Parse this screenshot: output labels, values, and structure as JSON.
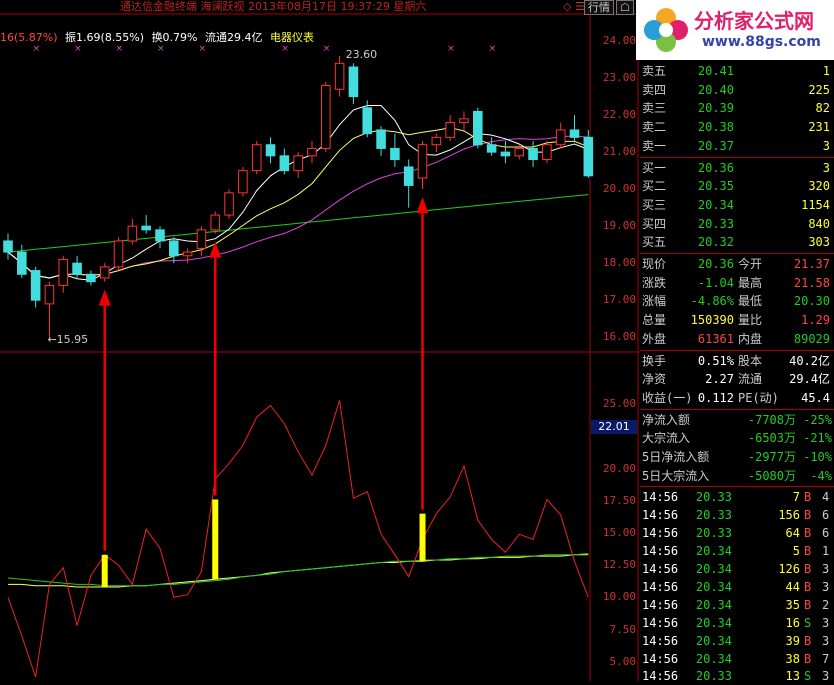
{
  "window": {
    "title": "通达信金融终端  海澜跃视 2013年08月17日 19:37:29 星期六",
    "quote_button": "行情",
    "extra_button": "☖",
    "small_controls": "◇ ☰"
  },
  "logo": {
    "line1": "分析家公式网",
    "line2": "www.88gs.com"
  },
  "info_bar": {
    "change": "16(5.87%)",
    "amplitude": "振1.69(8.55%)",
    "turnover": "换0.79%",
    "float": "流通29.4亿",
    "sector": "电器仪表"
  },
  "price_axis": [
    "24.00",
    "23.00",
    "22.00",
    "21.00",
    "20.00",
    "19.00",
    "18.00",
    "17.00",
    "16.00"
  ],
  "indicator_axis": [
    "25.00",
    "22.01",
    "20.00",
    "17.50",
    "15.00",
    "12.50",
    "10.00",
    "7.50",
    "5.00"
  ],
  "indicator_current": "22.01",
  "annotations": {
    "high": "23.60",
    "low": "←15.95"
  },
  "order_book": {
    "sell": [
      {
        "label": "卖五",
        "price": "20.41",
        "vol": "1"
      },
      {
        "label": "卖四",
        "price": "20.40",
        "vol": "225"
      },
      {
        "label": "卖三",
        "price": "20.39",
        "vol": "82"
      },
      {
        "label": "卖二",
        "price": "20.38",
        "vol": "231"
      },
      {
        "label": "卖一",
        "price": "20.37",
        "vol": "3"
      }
    ],
    "buy": [
      {
        "label": "买一",
        "price": "20.36",
        "vol": "3"
      },
      {
        "label": "买二",
        "price": "20.35",
        "vol": "320"
      },
      {
        "label": "买三",
        "price": "20.34",
        "vol": "1154"
      },
      {
        "label": "买四",
        "price": "20.33",
        "vol": "840"
      },
      {
        "label": "买五",
        "price": "20.32",
        "vol": "303"
      }
    ]
  },
  "stats": [
    {
      "l1": "现价",
      "v1": "20.36",
      "c1": "green",
      "l2": "今开",
      "v2": "21.37",
      "c2": "red"
    },
    {
      "l1": "涨跌",
      "v1": "-1.04",
      "c1": "green",
      "l2": "最高",
      "v2": "21.58",
      "c2": "red"
    },
    {
      "l1": "涨幅",
      "v1": "-4.86%",
      "c1": "green",
      "l2": "最低",
      "v2": "20.30",
      "c2": "green"
    },
    {
      "l1": "总量",
      "v1": "150390",
      "c1": "yellow",
      "l2": "量比",
      "v2": "1.29",
      "c2": "red"
    },
    {
      "l1": "外盘",
      "v1": "61361",
      "c1": "red",
      "l2": "内盘",
      "v2": "89029",
      "c2": "green"
    }
  ],
  "fundamentals": [
    {
      "l1": "换手",
      "v1": "0.51%",
      "l2": "股本",
      "v2": "40.2亿"
    },
    {
      "l1": "净资",
      "v1": "2.27",
      "l2": "流通",
      "v2": "29.4亿"
    },
    {
      "l1": "收益(一)",
      "v1": "0.112",
      "l2": "PE(动)",
      "v2": "45.4"
    }
  ],
  "flows": [
    {
      "label": "净流入额",
      "value": "-7708万",
      "pct": "-25%"
    },
    {
      "label": "大宗流入",
      "value": "-6503万",
      "pct": "-21%"
    },
    {
      "label": "5日净流入额",
      "value": "-2977万",
      "pct": "-10%"
    },
    {
      "label": "5日大宗流入",
      "value": "-5080万",
      "pct": "-4%"
    }
  ],
  "ticks": [
    {
      "time": "14:56",
      "price": "20.33",
      "vol": "7",
      "side": "B",
      "n": "4"
    },
    {
      "time": "14:56",
      "price": "20.33",
      "vol": "156",
      "side": "B",
      "n": "6"
    },
    {
      "time": "14:56",
      "price": "20.33",
      "vol": "64",
      "side": "B",
      "n": "6"
    },
    {
      "time": "14:56",
      "price": "20.34",
      "vol": "5",
      "side": "B",
      "n": "1"
    },
    {
      "time": "14:56",
      "price": "20.34",
      "vol": "126",
      "side": "B",
      "n": "3"
    },
    {
      "time": "14:56",
      "price": "20.34",
      "vol": "44",
      "side": "B",
      "n": "3"
    },
    {
      "time": "14:56",
      "price": "20.34",
      "vol": "35",
      "side": "B",
      "n": "2"
    },
    {
      "time": "14:56",
      "price": "20.34",
      "vol": "16",
      "side": "S",
      "n": "3"
    },
    {
      "time": "14:56",
      "price": "20.34",
      "vol": "39",
      "side": "B",
      "n": "3"
    },
    {
      "time": "14:56",
      "price": "20.34",
      "vol": "38",
      "side": "B",
      "n": "7"
    },
    {
      "time": "14:56",
      "price": "20.33",
      "vol": "13",
      "side": "S",
      "n": "3"
    }
  ],
  "colors": {
    "up": "#ff3333",
    "down": "#44dddd",
    "ma5": "#ffffff",
    "ma10": "#ffff66",
    "ma20": "#dd44dd",
    "ma60": "#22cc22",
    "signal": "#ffff00",
    "arrow": "#ee0000"
  },
  "chart_data": {
    "type": "candlestick",
    "price_range": [
      15.6,
      24.3
    ],
    "candles": [
      {
        "o": 18.6,
        "h": 18.8,
        "l": 18.1,
        "c": 18.3
      },
      {
        "o": 18.3,
        "h": 18.5,
        "l": 17.6,
        "c": 17.7
      },
      {
        "o": 17.8,
        "h": 17.9,
        "l": 16.8,
        "c": 17.0
      },
      {
        "o": 16.9,
        "h": 17.5,
        "l": 15.95,
        "c": 17.4
      },
      {
        "o": 17.4,
        "h": 18.2,
        "l": 17.2,
        "c": 18.1
      },
      {
        "o": 18.0,
        "h": 18.2,
        "l": 17.6,
        "c": 17.7
      },
      {
        "o": 17.7,
        "h": 17.8,
        "l": 17.4,
        "c": 17.5
      },
      {
        "o": 17.6,
        "h": 18.0,
        "l": 17.5,
        "c": 17.9
      },
      {
        "o": 17.9,
        "h": 18.7,
        "l": 17.8,
        "c": 18.6
      },
      {
        "o": 18.6,
        "h": 19.2,
        "l": 18.5,
        "c": 19.0
      },
      {
        "o": 19.0,
        "h": 19.3,
        "l": 18.8,
        "c": 18.9
      },
      {
        "o": 18.9,
        "h": 19.0,
        "l": 18.4,
        "c": 18.6
      },
      {
        "o": 18.6,
        "h": 18.7,
        "l": 18.0,
        "c": 18.2
      },
      {
        "o": 18.2,
        "h": 18.4,
        "l": 18.0,
        "c": 18.3
      },
      {
        "o": 18.4,
        "h": 19.0,
        "l": 18.2,
        "c": 18.9
      },
      {
        "o": 18.9,
        "h": 19.4,
        "l": 18.8,
        "c": 19.3
      },
      {
        "o": 19.3,
        "h": 20.0,
        "l": 19.2,
        "c": 19.9
      },
      {
        "o": 19.9,
        "h": 20.6,
        "l": 19.8,
        "c": 20.5
      },
      {
        "o": 20.5,
        "h": 21.3,
        "l": 20.4,
        "c": 21.2
      },
      {
        "o": 21.2,
        "h": 21.4,
        "l": 20.7,
        "c": 20.9
      },
      {
        "o": 20.9,
        "h": 21.1,
        "l": 20.4,
        "c": 20.5
      },
      {
        "o": 20.5,
        "h": 21.0,
        "l": 20.3,
        "c": 20.9
      },
      {
        "o": 20.9,
        "h": 21.3,
        "l": 20.7,
        "c": 21.1
      },
      {
        "o": 21.1,
        "h": 22.9,
        "l": 21.0,
        "c": 22.8
      },
      {
        "o": 22.7,
        "h": 23.6,
        "l": 22.5,
        "c": 23.4
      },
      {
        "o": 23.3,
        "h": 23.4,
        "l": 22.3,
        "c": 22.5
      },
      {
        "o": 22.2,
        "h": 22.4,
        "l": 21.4,
        "c": 21.5
      },
      {
        "o": 21.6,
        "h": 21.7,
        "l": 20.9,
        "c": 21.1
      },
      {
        "o": 21.1,
        "h": 21.5,
        "l": 20.6,
        "c": 20.8
      },
      {
        "o": 20.6,
        "h": 20.8,
        "l": 19.5,
        "c": 20.1
      },
      {
        "o": 20.3,
        "h": 21.3,
        "l": 20.0,
        "c": 21.2
      },
      {
        "o": 21.2,
        "h": 21.5,
        "l": 21.0,
        "c": 21.4
      },
      {
        "o": 21.4,
        "h": 22.0,
        "l": 21.3,
        "c": 21.8
      },
      {
        "o": 21.8,
        "h": 22.1,
        "l": 21.6,
        "c": 21.9
      },
      {
        "o": 22.1,
        "h": 22.2,
        "l": 21.1,
        "c": 21.2
      },
      {
        "o": 21.2,
        "h": 21.4,
        "l": 20.9,
        "c": 21.0
      },
      {
        "o": 21.0,
        "h": 21.3,
        "l": 20.7,
        "c": 20.9
      },
      {
        "o": 20.9,
        "h": 21.2,
        "l": 20.8,
        "c": 21.1
      },
      {
        "o": 21.1,
        "h": 21.3,
        "l": 20.6,
        "c": 20.8
      },
      {
        "o": 20.8,
        "h": 21.3,
        "l": 20.7,
        "c": 21.2
      },
      {
        "o": 21.2,
        "h": 21.8,
        "l": 21.1,
        "c": 21.6
      },
      {
        "o": 21.6,
        "h": 22.0,
        "l": 21.3,
        "c": 21.4
      },
      {
        "o": 21.4,
        "h": 21.6,
        "l": 20.3,
        "c": 20.36
      }
    ],
    "indicator_range": [
      3.5,
      27.5
    ],
    "indicator_line": [
      10.0,
      7.0,
      3.8,
      11.0,
      12.3,
      7.8,
      11.7,
      13.3,
      12.5,
      11.0,
      15.3,
      13.8,
      10.0,
      10.2,
      12.0,
      19.2,
      20.4,
      21.8,
      24.0,
      24.9,
      23.5,
      21.3,
      19.5,
      21.8,
      25.3,
      17.7,
      18.2,
      14.9,
      13.3,
      11.6,
      14.5,
      16.5,
      17.8,
      20.2,
      16.0,
      14.5,
      13.5,
      14.9,
      14.5,
      17.6,
      16.4,
      12.8,
      10.0
    ],
    "indicator_ma_a": [
      11.0,
      11.0,
      10.9,
      10.9,
      10.9,
      10.8,
      10.8,
      10.8,
      10.8,
      10.9,
      10.9,
      11.0,
      11.1,
      11.2,
      11.3,
      11.4,
      11.5,
      11.6,
      11.7,
      11.9,
      12.0,
      12.1,
      12.2,
      12.3,
      12.4,
      12.5,
      12.6,
      12.7,
      12.7,
      12.8,
      12.8,
      12.9,
      12.9,
      13.0,
      13.0,
      13.1,
      13.1,
      13.1,
      13.2,
      13.2,
      13.2,
      13.3,
      13.3
    ],
    "indicator_ma_b": [
      11.5,
      11.4,
      11.3,
      11.2,
      11.1,
      11.0,
      11.0,
      10.9,
      10.9,
      10.9,
      10.9,
      11.0,
      11.0,
      11.1,
      11.2,
      11.3,
      11.4,
      11.6,
      11.7,
      11.8,
      12.0,
      12.1,
      12.2,
      12.3,
      12.4,
      12.5,
      12.6,
      12.7,
      12.8,
      12.8,
      12.9,
      12.9,
      13.0,
      13.0,
      13.1,
      13.1,
      13.2,
      13.2,
      13.2,
      13.3,
      13.3,
      13.3,
      13.4
    ],
    "signals": [
      {
        "index": 7,
        "value": 13.3
      },
      {
        "index": 15,
        "value": 17.6
      },
      {
        "index": 30,
        "value": 16.5
      }
    ]
  }
}
